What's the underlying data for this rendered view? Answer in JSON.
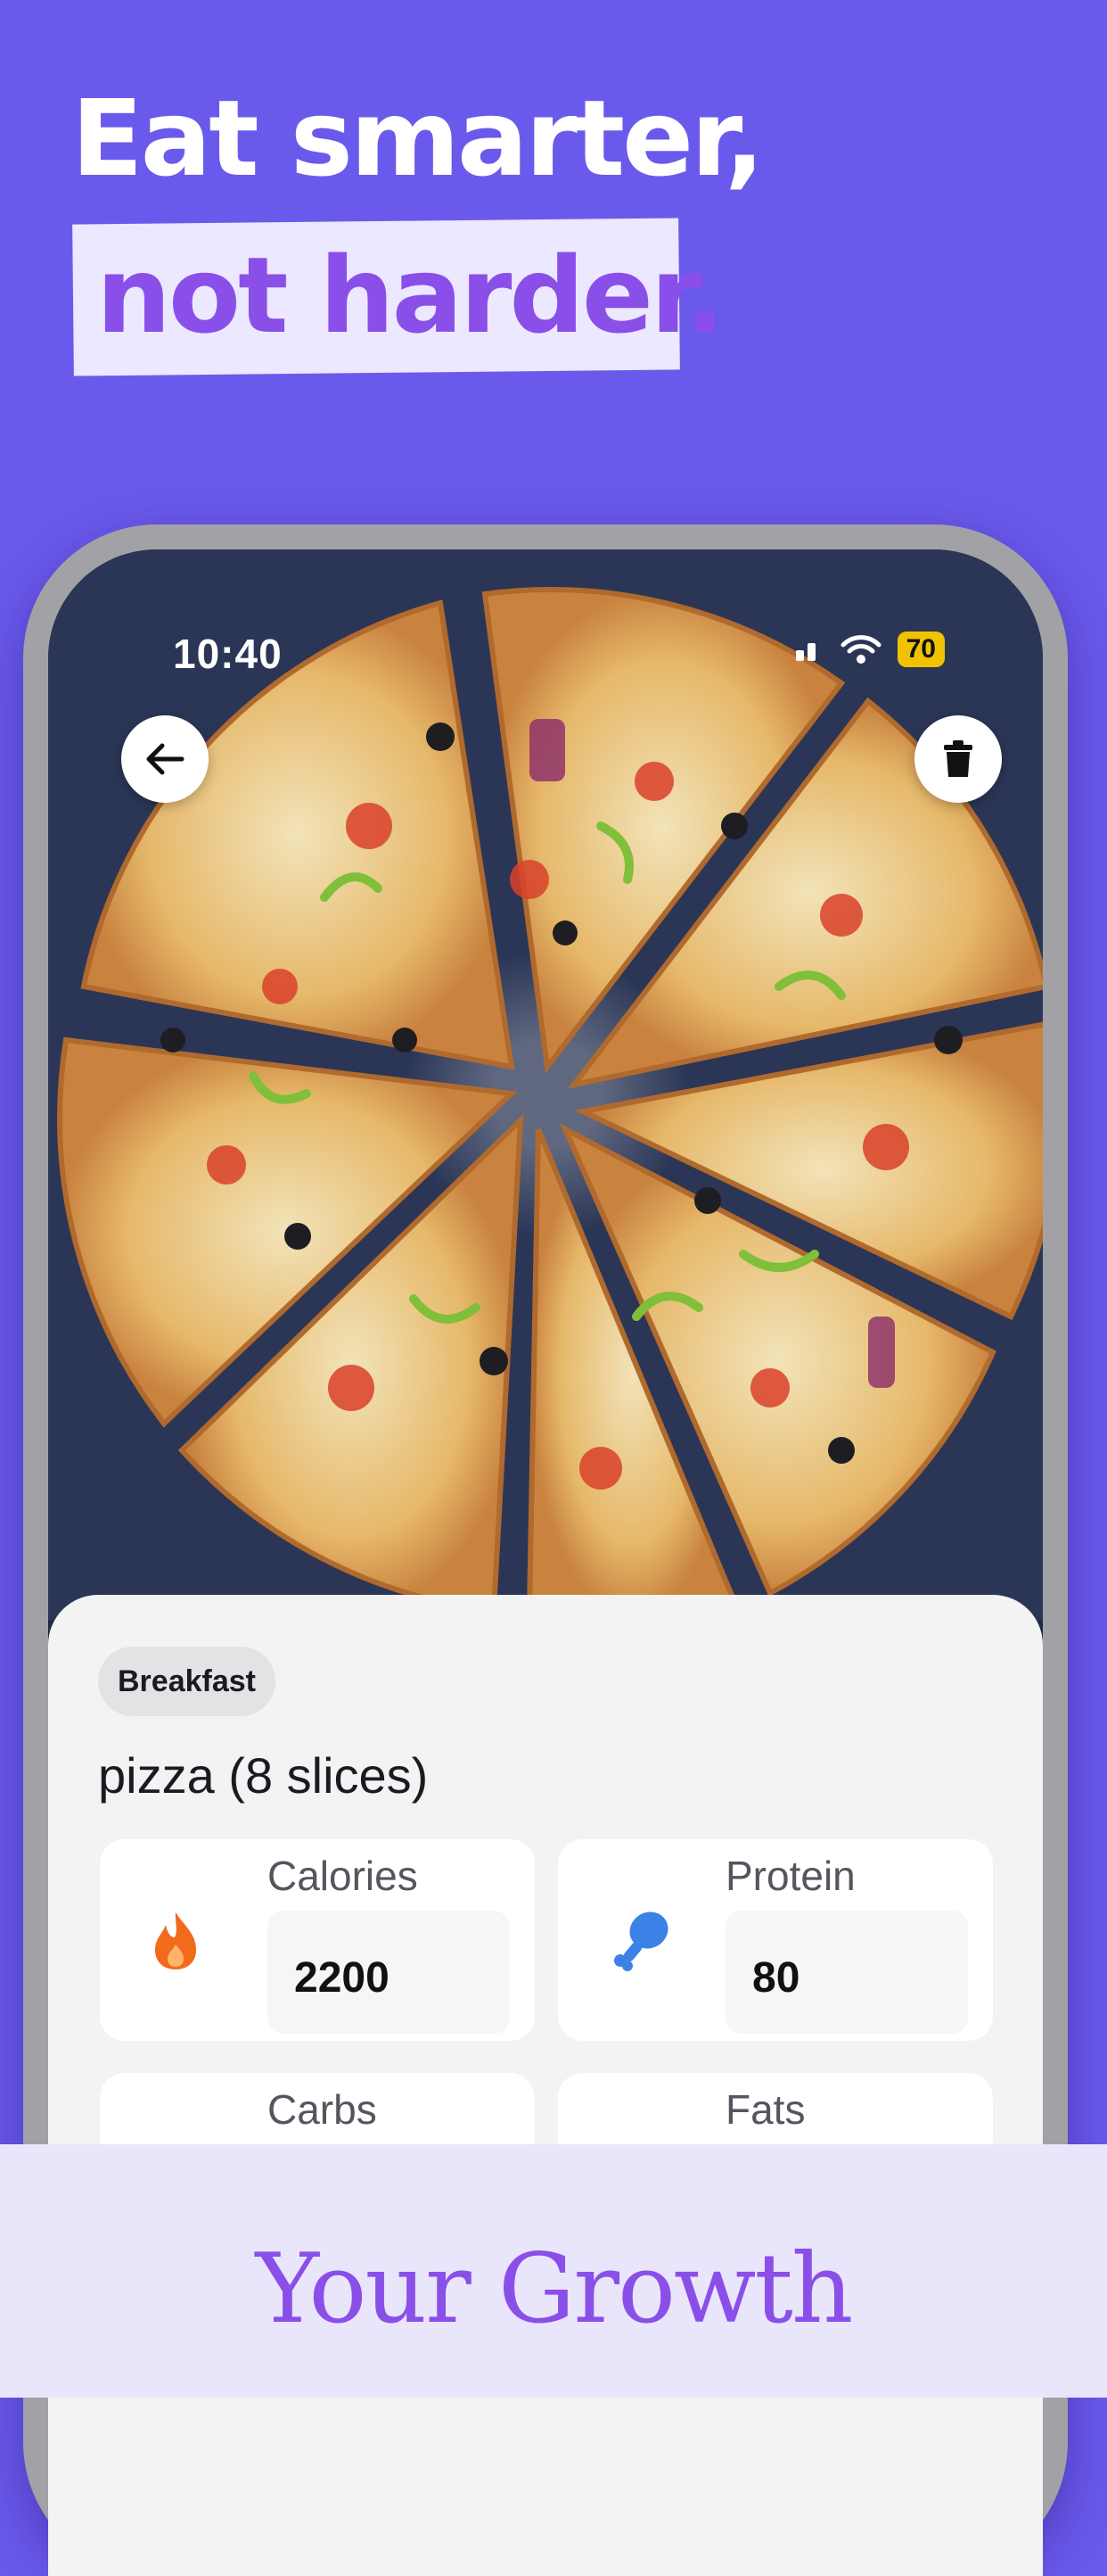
{
  "headline": {
    "line1": "Eat smarter,",
    "line2": "not harder."
  },
  "status_bar": {
    "time": "10:40",
    "battery": "70"
  },
  "toolbar": {
    "back_icon": "arrow-left-icon",
    "delete_icon": "trash-icon"
  },
  "meal": {
    "tag": "Breakfast",
    "name": "pizza (8 slices)"
  },
  "nutrition": [
    {
      "label": "Calories",
      "value": "2200",
      "icon": "flame-icon",
      "color": "#F26A1B"
    },
    {
      "label": "Protein",
      "value": "80",
      "icon": "drumstick-icon",
      "color": "#3C82E6"
    },
    {
      "label": "Carbs",
      "value": ""
    },
    {
      "label": "Fats",
      "value": ""
    }
  ],
  "banner": {
    "text": "Your Growth"
  },
  "colors": {
    "background": "#6A5AEC",
    "accent": "#8A4FE8",
    "highlight": "#ECE8FF"
  }
}
